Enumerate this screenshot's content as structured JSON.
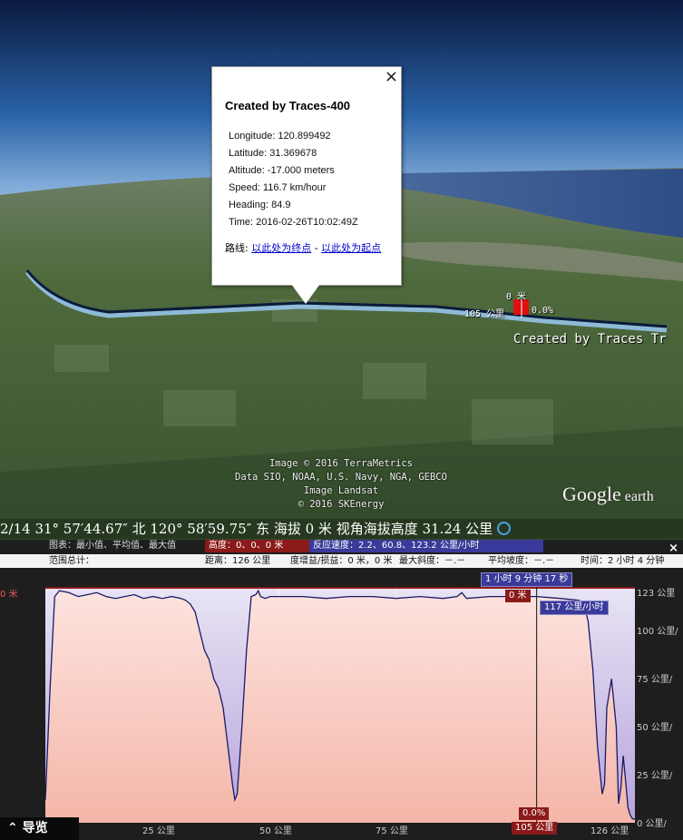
{
  "balloon": {
    "close_glyph": "×",
    "title": "Created by Traces-400",
    "rows": [
      "Longitude: 120.899492",
      "Latitude: 31.369678",
      "Altitude: -17.000 meters",
      "Speed: 116.7 km/hour",
      "Heading: 84.9",
      "Time: 2016-02-26T10:02:49Z"
    ],
    "route_prefix": "路线: ",
    "route_to": "以此处为终点",
    "route_sep": " - ",
    "route_from": "以此处为起点"
  },
  "map": {
    "trace_label": "Created by Traces Tr",
    "marker_top": "0 米",
    "marker_left": "105 公里",
    "marker_right": "0.0%",
    "credits": [
      "Image © 2016 TerraMetrics",
      "Data SIO, NOAA, U.S. Navy, NGA, GEBCO",
      "Image Landsat",
      "© 2016 SKEnergy"
    ],
    "logo_main": "Google",
    "logo_sub": " earth"
  },
  "status": {
    "text": "2/14   31° 57′44.67″ 北 120° 58′59.75″ 东 海拔       0 米   视角海拔高度   31.24 公里"
  },
  "profile": {
    "legend_label": "图表：最小值、平均值、最大值",
    "height_tag": "高度：0、0、0 米",
    "speed_tag": "反应速度：2.2、60.8、123.2 公里/小时",
    "range_label": "范围总计：",
    "distance": "距离：126 公里",
    "elev_gain": "度增益/损益：0 米，0 米",
    "max_slope": "最大斜度：－.－",
    "avg_slope": "平均坡度：－.－",
    "time": "时间：2 小时 4 分钟",
    "close_glyph": "×",
    "cursor_time": "1 小时 9 分钟 17 秒",
    "cursor_height": "0 米",
    "cursor_speed": "117 公里/小时",
    "cursor_slope": "0.0%",
    "cursor_distance": "105 公里",
    "left_axis_label": "0 米",
    "right_axis": [
      "123 公里",
      "100 公里/",
      "75 公里/",
      "50 公里/",
      "25 公里/",
      "0 公里/"
    ],
    "x_ticks": [
      "25 公里",
      "50 公里",
      "75 公里",
      "126 公里"
    ],
    "nav_label": "导览",
    "colors": {
      "height": "#8b1a1a",
      "speed": "#3a3a9a",
      "speed_line": "#1a1a66"
    }
  },
  "chart_data": {
    "type": "line",
    "title": "",
    "xlabel": "",
    "ylabel": "",
    "x_unit": "公里",
    "xlim": [
      0,
      126
    ],
    "ylim": [
      0,
      123
    ],
    "series": [
      {
        "x": [
          0,
          1,
          2,
          3,
          5,
          7,
          9,
          11,
          13,
          15,
          17,
          19,
          21,
          23,
          25,
          27,
          29,
          30,
          31,
          32,
          33,
          34,
          35,
          36,
          37,
          38,
          39,
          40,
          40.5,
          41,
          42,
          43,
          44,
          45,
          45.5,
          46,
          47,
          48,
          50,
          55,
          60,
          65,
          70,
          75,
          80,
          85,
          88,
          89,
          90,
          95,
          100,
          105,
          110,
          114,
          115,
          116,
          117,
          118,
          119,
          119.5,
          120,
          121,
          122,
          122.5,
          123,
          123.5,
          124,
          124.5,
          125,
          125.5,
          126
        ],
        "y": [
          12,
          70,
          118,
          121,
          120,
          118,
          119,
          120,
          118,
          117,
          118,
          119,
          117,
          118,
          117,
          118,
          117,
          116,
          114,
          110,
          100,
          90,
          85,
          75,
          70,
          60,
          40,
          20,
          12,
          15,
          50,
          90,
          118,
          119,
          121,
          118,
          117,
          118,
          118,
          118,
          117,
          118,
          118,
          117,
          118,
          117,
          118,
          120,
          117,
          118,
          118,
          118,
          117,
          116,
          115,
          105,
          80,
          40,
          15,
          20,
          60,
          75,
          50,
          10,
          18,
          35,
          22,
          8,
          4,
          2,
          2
        ]
      }
    ],
    "cursor_x": 105
  }
}
